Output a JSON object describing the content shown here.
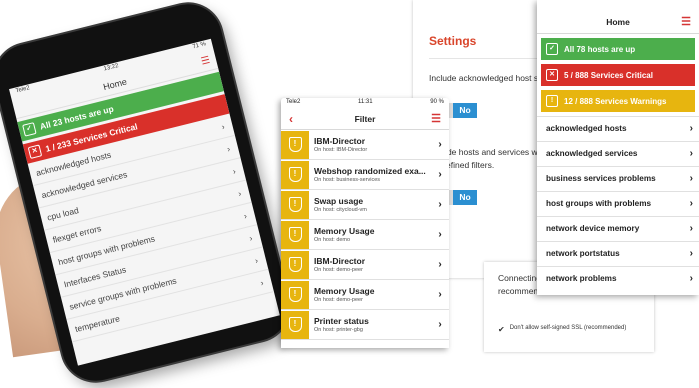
{
  "phone": {
    "status_left": "Tele2",
    "status_time": "13:22",
    "status_right": "71 %",
    "title": "Home",
    "banners": [
      {
        "label": "All 23 hosts are up",
        "color": "#4cae4c"
      },
      {
        "label": "1 / 233 Services Critical",
        "color": "#d9302a"
      }
    ],
    "items": [
      "acknowledged hosts",
      "acknowledged services",
      "cpu load",
      "flexget errors",
      "host groups with problems",
      "Interfaces Status",
      "service groups with problems",
      "temperature"
    ]
  },
  "settings": {
    "title": "Settings",
    "text1": "Include acknowledged host services in predefined filter",
    "toggle1": "No",
    "text2": "Include hosts and services w scheduled downtime in predefined filters.",
    "toggle2": "No"
  },
  "ssl": {
    "text": "Connecting signed SSL and not recommend.",
    "checkbox_label": "Don't allow self-signed SSL (recommended)"
  },
  "filter": {
    "status_left": "Tele2",
    "status_time": "11:31",
    "status_right": "90 %",
    "title": "Filter",
    "rows": [
      {
        "name": "IBM-Director",
        "host": "On host: IBM-Director"
      },
      {
        "name": "Webshop randomized exa...",
        "host": "On host: business-services"
      },
      {
        "name": "Swap usage",
        "host": "On host: citycloud-vm"
      },
      {
        "name": "Memory Usage",
        "host": "On host: demo"
      },
      {
        "name": "IBM-Director",
        "host": "On host: demo-peer"
      },
      {
        "name": "Memory Usage",
        "host": "On host: demo-peer"
      },
      {
        "name": "Printer status",
        "host": "On host: printer-gbg"
      }
    ]
  },
  "home": {
    "title": "Home",
    "banners": [
      {
        "label": "All 78 hosts are up",
        "color": "#4cae4c"
      },
      {
        "label": "5 / 888 Services Critical",
        "color": "#d9302a"
      },
      {
        "label": "12 / 888 Services Warnings",
        "color": "#e7b50f"
      }
    ],
    "items": [
      "acknowledged hosts",
      "acknowledged services",
      "business services problems",
      "host groups with problems",
      "network device memory",
      "network portstatus",
      "network problems"
    ]
  }
}
